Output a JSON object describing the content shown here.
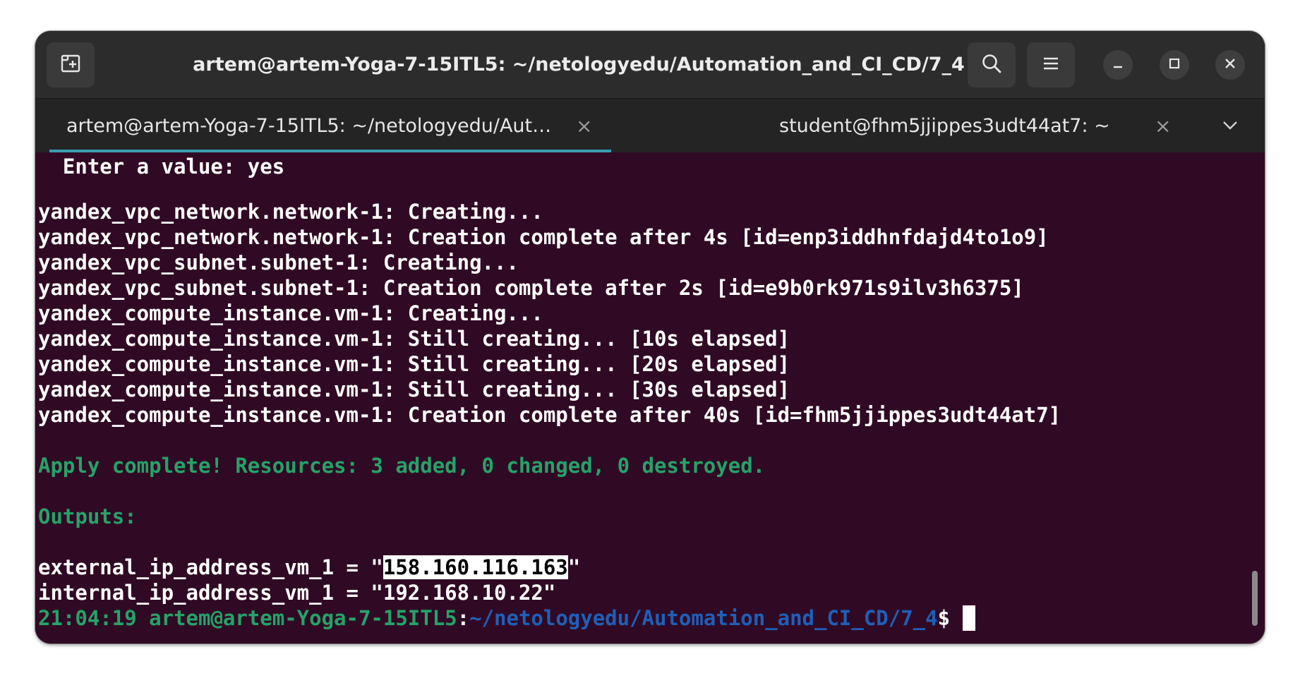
{
  "window": {
    "title": "artem@artem-Yoga-7-15ITL5: ~/netologyedu/Automation_and_CI_CD/7_4"
  },
  "header_buttons": {
    "new_tab_icon": "new-tab-icon",
    "search_icon": "search-icon",
    "menu_icon": "hamburger-menu-icon",
    "minimize_icon": "minimize-icon",
    "maximize_icon": "maximize-icon",
    "close_icon": "close-icon"
  },
  "tabs": [
    {
      "label": "artem@artem-Yoga-7-15ITL5: ~/netologyedu/Aut…",
      "close": "×",
      "active": true
    },
    {
      "label": "student@fhm5jjippes3udt44at7: ~",
      "close": "×",
      "active": false
    }
  ],
  "tab_menu_icon": "chevron-down-icon",
  "colors": {
    "terminal_bg": "#300a24",
    "green": "#26a269",
    "blue": "#1f5fb8",
    "tab_indicator": "#3c9db0"
  },
  "terminal": {
    "prompt_line": "  Enter a value: yes",
    "lines": [
      "yandex_vpc_network.network-1: Creating...",
      "yandex_vpc_network.network-1: Creation complete after 4s [id=enp3iddhnfdajd4to1o9]",
      "yandex_vpc_subnet.subnet-1: Creating...",
      "yandex_vpc_subnet.subnet-1: Creation complete after 2s [id=e9b0rk971s9ilv3h6375]",
      "yandex_compute_instance.vm-1: Creating...",
      "yandex_compute_instance.vm-1: Still creating... [10s elapsed]",
      "yandex_compute_instance.vm-1: Still creating... [20s elapsed]",
      "yandex_compute_instance.vm-1: Still creating... [30s elapsed]",
      "yandex_compute_instance.vm-1: Creation complete after 40s [id=fhm5jjippes3udt44at7]"
    ],
    "apply_complete": "Apply complete! Resources: 3 added, 0 changed, 0 destroyed.",
    "outputs_header": "Outputs:",
    "external_prefix": "external_ip_address_vm_1 = \"",
    "external_ip": "158.160.116.163",
    "external_suffix": "\"",
    "internal_line": "internal_ip_address_vm_1 = \"192.168.10.22\"",
    "prompt": {
      "time": "21:04:19",
      "user_host": "artem@artem-Yoga-7-15ITL5",
      "colon": ":",
      "path": "~/netologyedu/Automation_and_CI_CD/7_4",
      "dollar": "$ "
    }
  }
}
